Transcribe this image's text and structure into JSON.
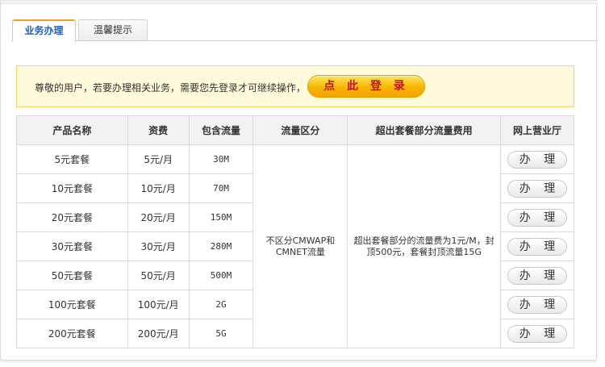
{
  "tabs": [
    {
      "label": "业务办理",
      "active": true
    },
    {
      "label": "温馨提示",
      "active": false
    }
  ],
  "notice": {
    "text": "尊敬的用户，若要办理相关业务，需要您先登录才可继续操作，",
    "login_label": "点 此 登 录"
  },
  "table": {
    "headers": [
      "产品名称",
      "资费",
      "包含流量",
      "流量区分",
      "超出套餐部分流量费用",
      "网上营业厅"
    ],
    "rows": [
      {
        "name": "5元套餐",
        "price": "5元/月",
        "traffic": "30M"
      },
      {
        "name": "10元套餐",
        "price": "10元/月",
        "traffic": "70M"
      },
      {
        "name": "20元套餐",
        "price": "20元/月",
        "traffic": "150M"
      },
      {
        "name": "30元套餐",
        "price": "30元/月",
        "traffic": "280M"
      },
      {
        "name": "50元套餐",
        "price": "50元/月",
        "traffic": "500M"
      },
      {
        "name": "100元套餐",
        "price": "100元/月",
        "traffic": "2G"
      },
      {
        "name": "200元套餐",
        "price": "200元/月",
        "traffic": "5G"
      }
    ],
    "distinction": "不区分CMWAP和CMNET流量",
    "overage": "超出套餐部分的流量费为1元/M，封顶500元，套餐封顶流量15G",
    "action_label": "办 理"
  },
  "colors": {
    "tab_active_text": "#1f5fb5",
    "tab_active_top": "#f0a21c",
    "notice_bg": "#fefbdc",
    "notice_border": "#f0d36b",
    "login_text": "#c0141c",
    "login_bg": "#f7b500"
  }
}
